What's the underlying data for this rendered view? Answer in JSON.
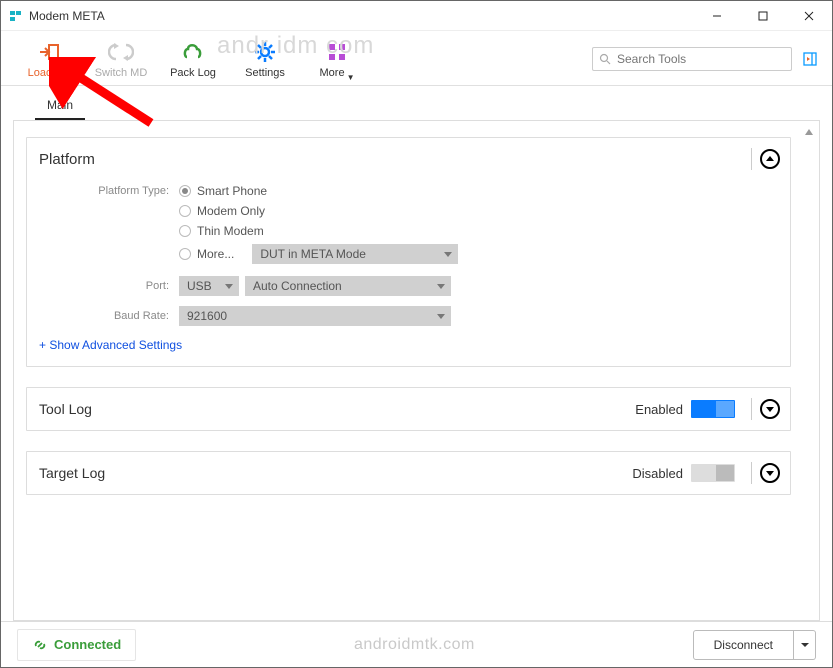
{
  "window": {
    "title": "Modem META"
  },
  "toolbar": {
    "load_db": "Load DB",
    "switch_md": "Switch MD",
    "pack_log": "Pack Log",
    "settings": "Settings",
    "more": "More"
  },
  "search": {
    "placeholder": "Search Tools"
  },
  "tabs": {
    "main": "Main"
  },
  "platform": {
    "title": "Platform",
    "type_label": "Platform Type:",
    "opt_smart_phone": "Smart Phone",
    "opt_modem_only": "Modem Only",
    "opt_thin_modem": "Thin Modem",
    "opt_more": "More...",
    "more_dropdown": "DUT in META Mode",
    "port_label": "Port:",
    "port_value": "USB",
    "port_conn": "Auto Connection",
    "baud_label": "Baud Rate:",
    "baud_value": "921600",
    "show_advanced": "+ Show Advanced Settings"
  },
  "tool_log": {
    "title": "Tool Log",
    "status": "Enabled"
  },
  "target_log": {
    "title": "Target Log",
    "status": "Disabled"
  },
  "status": {
    "connected": "Connected",
    "watermark": "androidmtk.com",
    "disconnect": "Disconnect"
  },
  "toolbar_watermark": "andr    idm     com"
}
